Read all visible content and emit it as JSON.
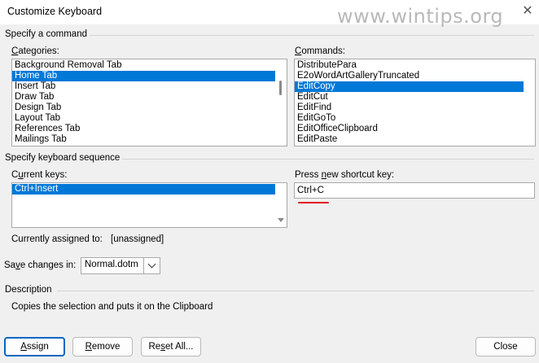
{
  "window": {
    "title": "Customize Keyboard",
    "watermark": "www.wintips.org"
  },
  "command_group": {
    "title": "Specify a command",
    "categories_label_key": "C",
    "categories_label_rest": "ategories:",
    "categories": [
      "Background Removal Tab",
      "Home Tab",
      "Insert Tab",
      "Draw Tab",
      "Design Tab",
      "Layout Tab",
      "References Tab",
      "Mailings Tab"
    ],
    "categories_selected": "Home Tab",
    "commands_label_key": "C",
    "commands_label_rest": "ommands:",
    "commands": [
      "DistributePara",
      "E2oWordArtGalleryTruncated",
      "EditCopy",
      "EditCut",
      "EditFind",
      "EditGoTo",
      "EditOfficeClipboard",
      "EditPaste"
    ],
    "commands_selected": "EditCopy"
  },
  "keyboard_group": {
    "title": "Specify keyboard sequence",
    "current_keys_label_key": "u",
    "current_keys_label_pre": "C",
    "current_keys_label_rest": "rrent keys:",
    "current_keys": [
      "Ctrl+Insert"
    ],
    "new_key_label_pre": "Press ",
    "new_key_label_key": "n",
    "new_key_label_rest": "ew shortcut key:",
    "new_key_value": "Ctrl+C",
    "currently_assigned_label": "Currently assigned to:",
    "currently_assigned_value": "[unassigned]",
    "save_changes_label_pre": "Sa",
    "save_changes_label_key": "v",
    "save_changes_label_rest": "e changes in:",
    "save_changes_value": "Normal.dotm"
  },
  "description_group": {
    "title": "Description",
    "text": "Copies the selection and puts it on the Clipboard"
  },
  "buttons": {
    "assign_key": "A",
    "assign_rest": "ssign",
    "remove_key": "R",
    "remove_rest": "emove",
    "reset_pre": "Re",
    "reset_key": "s",
    "reset_rest": "et All...",
    "close": "Close"
  },
  "colors": {
    "selection": "#0078d7",
    "accent_button_border": "#0067c0",
    "red_underline": "#e0141e"
  }
}
